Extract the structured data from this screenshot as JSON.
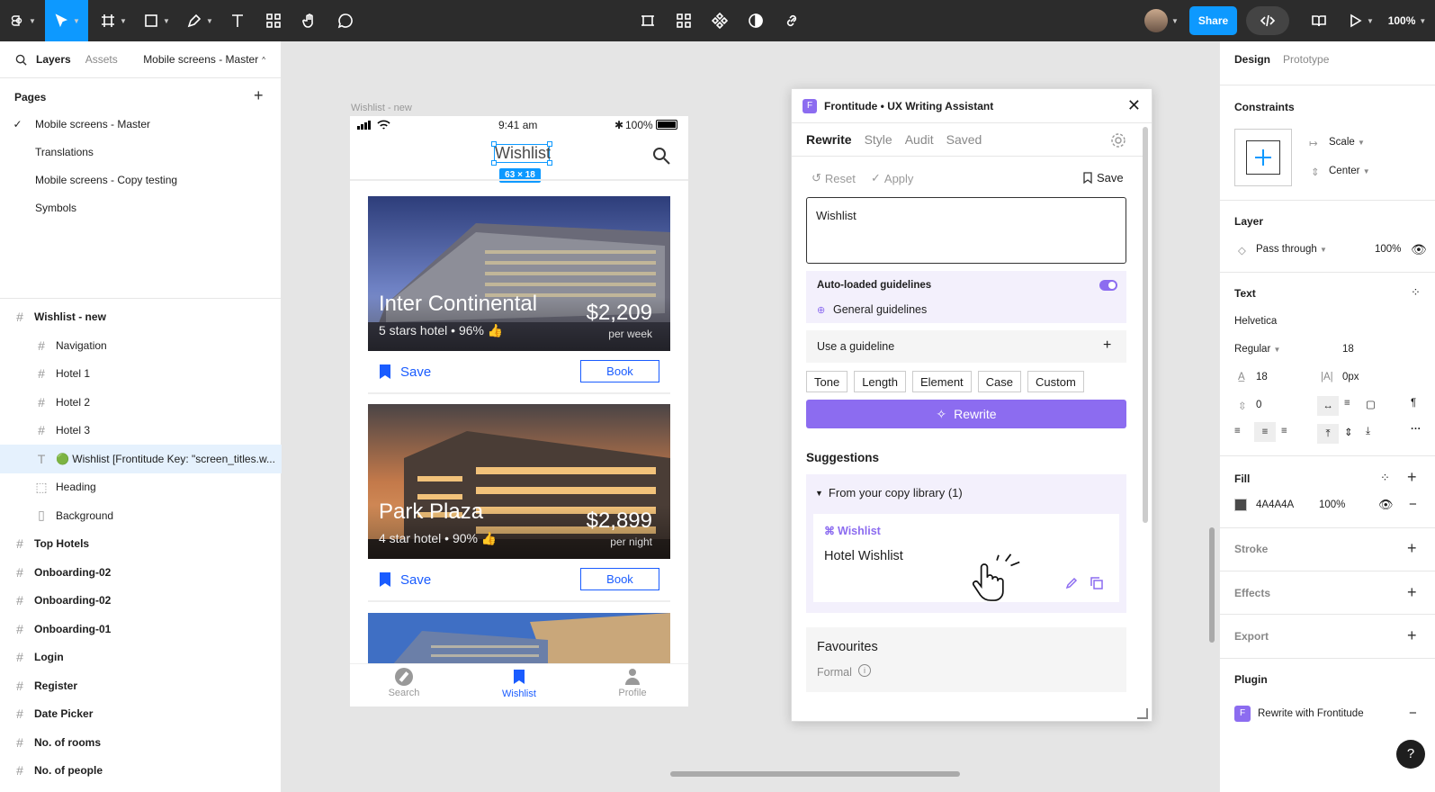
{
  "toolbar": {
    "share_label": "Share",
    "zoom": "100%",
    "colors": {
      "bg": "#2c2c2c",
      "accent": "#0d99ff"
    }
  },
  "left_panel": {
    "tabs": {
      "layers": "Layers",
      "assets": "Assets"
    },
    "file_name": "Mobile screens - Master",
    "pages_title": "Pages",
    "pages": [
      {
        "label": "Mobile screens - Master",
        "current": true
      },
      {
        "label": "Translations",
        "current": false
      },
      {
        "label": "Mobile screens - Copy testing",
        "current": false
      },
      {
        "label": "Symbols",
        "current": false
      }
    ],
    "layers": [
      {
        "label": "Wishlist - new",
        "bold": true,
        "indent": 0,
        "icon": "frame-icon"
      },
      {
        "label": "Navigation",
        "bold": false,
        "indent": 1,
        "icon": "frame-icon"
      },
      {
        "label": "Hotel 1",
        "bold": false,
        "indent": 1,
        "icon": "frame-icon"
      },
      {
        "label": "Hotel 2",
        "bold": false,
        "indent": 1,
        "icon": "frame-icon"
      },
      {
        "label": "Hotel 3",
        "bold": false,
        "indent": 1,
        "icon": "frame-icon"
      },
      {
        "label": "🟢 Wishlist [Frontitude Key: \"screen_titles.w...",
        "bold": false,
        "indent": 1,
        "icon": "text-icon",
        "selected": true
      },
      {
        "label": "Heading",
        "bold": false,
        "indent": 1,
        "icon": "section-icon"
      },
      {
        "label": "Background",
        "bold": false,
        "indent": 1,
        "icon": "rect-icon"
      },
      {
        "label": "Top Hotels",
        "bold": true,
        "indent": 0,
        "icon": "frame-icon"
      },
      {
        "label": "Onboarding-02",
        "bold": true,
        "indent": 0,
        "icon": "frame-icon"
      },
      {
        "label": "Onboarding-02",
        "bold": true,
        "indent": 0,
        "icon": "frame-icon"
      },
      {
        "label": "Onboarding-01",
        "bold": true,
        "indent": 0,
        "icon": "frame-icon"
      },
      {
        "label": "Login",
        "bold": true,
        "indent": 0,
        "icon": "frame-icon"
      },
      {
        "label": "Register",
        "bold": true,
        "indent": 0,
        "icon": "frame-icon"
      },
      {
        "label": "Date Picker",
        "bold": true,
        "indent": 0,
        "icon": "frame-icon"
      },
      {
        "label": "No. of rooms",
        "bold": true,
        "indent": 0,
        "icon": "frame-icon"
      },
      {
        "label": "No. of people",
        "bold": true,
        "indent": 0,
        "icon": "frame-icon"
      }
    ]
  },
  "canvas": {
    "frame_label": "Wishlist - new",
    "status": {
      "time": "9:41 am",
      "battery": "100%"
    },
    "title": "Wishlist",
    "selection_size": "63 × 18",
    "hotels": [
      {
        "name": "Inter Continental",
        "sub": "5 stars hotel • 96%",
        "price": "$2,209",
        "per": "per week",
        "save": "Save",
        "book": "Book"
      },
      {
        "name": "Park Plaza",
        "sub": "4 star hotel • 90%",
        "price": "$2,899",
        "per": "per night",
        "save": "Save",
        "book": "Book"
      }
    ],
    "nav": [
      {
        "label": "Search",
        "active": false
      },
      {
        "label": "Wishlist",
        "active": true
      },
      {
        "label": "Profile",
        "active": false
      }
    ]
  },
  "plugin": {
    "title": "Frontitude • UX Writing Assistant",
    "tabs": [
      "Rewrite",
      "Style",
      "Audit",
      "Saved"
    ],
    "reset": "Reset",
    "apply": "Apply",
    "save": "Save",
    "input_value": "Wishlist",
    "auto_guidelines": "Auto-loaded guidelines",
    "general_guidelines": "General guidelines",
    "use_guideline": "Use a guideline",
    "chips": [
      "Tone",
      "Length",
      "Element",
      "Case",
      "Custom"
    ],
    "rewrite_button": "Rewrite",
    "suggestions_title": "Suggestions",
    "library_label": "From your copy library (1)",
    "library_item_key": "Wishlist",
    "library_item_text": "Hotel Wishlist",
    "fav_title": "Favourites",
    "fav_sub": "Formal",
    "accent": "#8c6cf0"
  },
  "right_panel": {
    "tabs": {
      "design": "Design",
      "prototype": "Prototype"
    },
    "constraints_title": "Constraints",
    "constraint_h": "Scale",
    "constraint_v": "Center",
    "layer_title": "Layer",
    "blend": "Pass through",
    "layer_opacity": "100%",
    "text_title": "Text",
    "font": "Helvetica",
    "weight": "Regular",
    "size": "18",
    "line_height": "18",
    "letter_spacing": "0px",
    "para_spacing": "0",
    "fill_title": "Fill",
    "fill_hex": "4A4A4A",
    "fill_color": "#4a4a4a",
    "fill_opacity": "100%",
    "stroke_title": "Stroke",
    "effects_title": "Effects",
    "export_title": "Export",
    "plugin_title": "Plugin",
    "plugin_item": "Rewrite with Frontitude",
    "help": "?"
  }
}
